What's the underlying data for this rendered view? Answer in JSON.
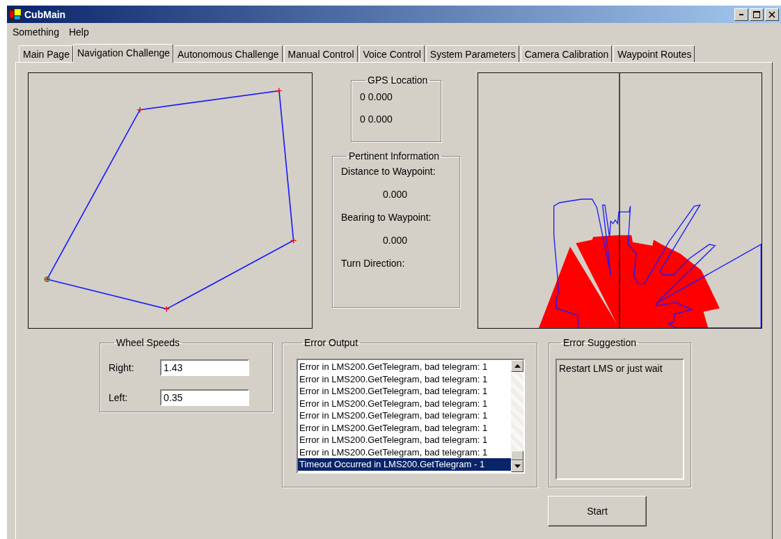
{
  "window": {
    "title": "CubMain"
  },
  "menu": [
    "Something",
    "Help"
  ],
  "tabs": [
    {
      "label": "Main Page",
      "selected": false
    },
    {
      "label": "Navigation Challenge",
      "selected": true
    },
    {
      "label": "Autonomous Challenge",
      "selected": false
    },
    {
      "label": "Manual Control",
      "selected": false
    },
    {
      "label": "Voice Control",
      "selected": false
    },
    {
      "label": "System Parameters",
      "selected": false
    },
    {
      "label": "Camera Calibration",
      "selected": false
    },
    {
      "label": "Waypoint Routes",
      "selected": false
    }
  ],
  "gps_location": {
    "title": "GPS Location",
    "values": [
      "0 0.000",
      "0 0.000"
    ]
  },
  "pertinent_information": {
    "title": "Pertinent Information",
    "items": [
      {
        "label": "Distance to Waypoint:",
        "value": "0.000"
      },
      {
        "label": "Bearing to Waypoint:",
        "value": "0.000"
      },
      {
        "label": "Turn Direction:"
      }
    ]
  },
  "wheel_speeds": {
    "title": "Wheel Speeds",
    "fields": [
      {
        "label": "Right:",
        "value": "1.43"
      },
      {
        "label": "Left:",
        "value": "0.35"
      }
    ]
  },
  "error_output": {
    "title": "Error Output",
    "items": [
      {
        "text": "Error in LMS200.GetTelegram, bad telegram: 1",
        "selected": false
      },
      {
        "text": "Error in LMS200.GetTelegram, bad telegram: 1",
        "selected": false
      },
      {
        "text": "Error in LMS200.GetTelegram, bad telegram: 1",
        "selected": false
      },
      {
        "text": "Error in LMS200.GetTelegram, bad telegram: 1",
        "selected": false
      },
      {
        "text": "Error in LMS200.GetTelegram, bad telegram: 1",
        "selected": false
      },
      {
        "text": "Error in LMS200.GetTelegram, bad telegram: 1",
        "selected": false
      },
      {
        "text": "Error in LMS200.GetTelegram, bad telegram: 1",
        "selected": false
      },
      {
        "text": "Error in LMS200.GetTelegram, bad telegram: 1",
        "selected": false
      },
      {
        "text": "Timeout Occurred in LMS200.GetTelegram - 1",
        "selected": true
      }
    ]
  },
  "error_suggestion": {
    "title": "Error Suggestion",
    "text": "Restart LMS or just wait"
  },
  "buttons": [
    "Start"
  ]
}
